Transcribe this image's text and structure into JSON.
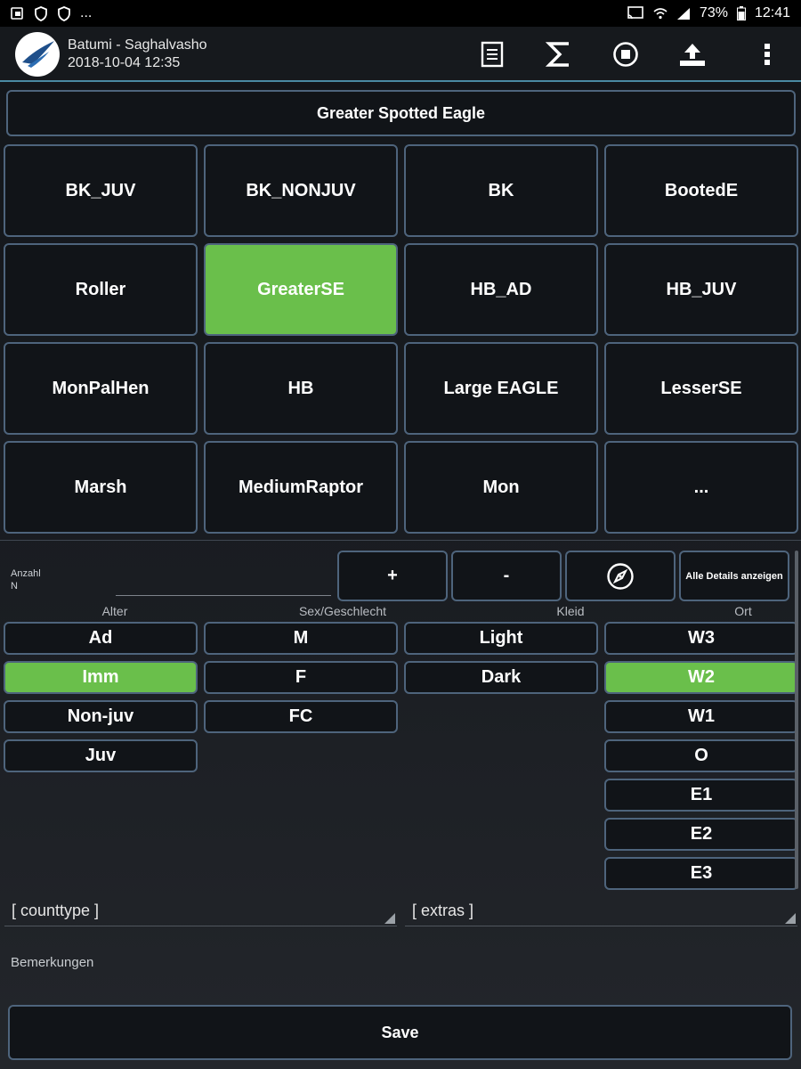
{
  "status_bar": {
    "battery": "73%",
    "time": "12:41",
    "left_more": "..."
  },
  "app_bar": {
    "location": "Batumi - Saghalvasho",
    "datetime": "2018-10-04 12:35"
  },
  "species_header": "Greater Spotted Eagle",
  "species": [
    "BK_JUV",
    "BK_NONJUV",
    "BK",
    "BootedE",
    "Roller",
    "GreaterSE",
    "HB_AD",
    "HB_JUV",
    "MonPalHen",
    "HB",
    "Large EAGLE",
    "LesserSE",
    "Marsh",
    "MediumRaptor",
    "Mon",
    "..."
  ],
  "selected_species": "GreaterSE",
  "count": {
    "label": "Anzahl",
    "sub_label": "N",
    "value": "",
    "plus": "+",
    "minus": "-",
    "details": "Alle Details anzeigen"
  },
  "columns": {
    "age": "Alter",
    "sex": "Sex/Geschlecht",
    "plumage": "Kleid",
    "location": "Ort"
  },
  "age_options": [
    "Ad",
    "Imm",
    "Non-juv",
    "Juv"
  ],
  "sex_options": [
    "M",
    "F",
    "FC"
  ],
  "plumage_options": [
    "Light",
    "Dark"
  ],
  "location_options": [
    "W3",
    "W2",
    "W1",
    "O",
    "E1",
    "E2",
    "E3"
  ],
  "selected_age": "Imm",
  "selected_location": "W2",
  "counttype": "[ counttype ]",
  "extras": "[ extras ]",
  "remarks_placeholder": "Bemerkungen",
  "save": "Save",
  "colors": {
    "selected": "#6abf4b",
    "border": "#4e647c",
    "accent_line": "#4a8aa3"
  }
}
